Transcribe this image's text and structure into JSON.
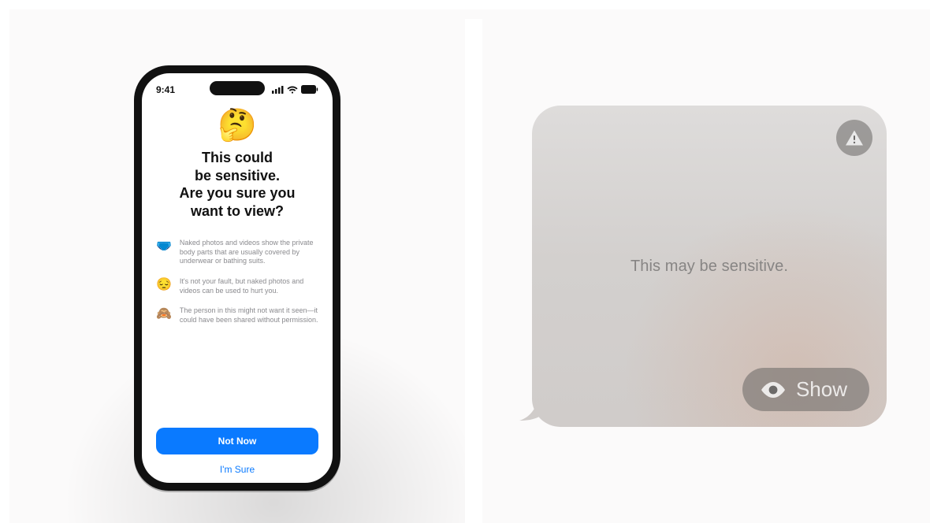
{
  "phone": {
    "time": "9:41",
    "warning": {
      "emoji": "🤔",
      "title_line1": "This could",
      "title_line2": "be sensitive.",
      "title_line3": "Are you sure you",
      "title_line4": "want to view?",
      "bullets": [
        {
          "icon": "🩲",
          "text": "Naked photos and videos show the private body parts that are usually covered by underwear or bathing suits."
        },
        {
          "icon": "😔",
          "text": "It's not your fault, but naked photos and videos can be used to hurt you."
        },
        {
          "icon": "🙈",
          "text": "The person in this might not want it seen—it could have been shared without permission."
        }
      ],
      "primary_button": "Not Now",
      "secondary_button": "I'm Sure"
    }
  },
  "message_bubble": {
    "label": "This may be sensitive.",
    "show_button": "Show"
  }
}
